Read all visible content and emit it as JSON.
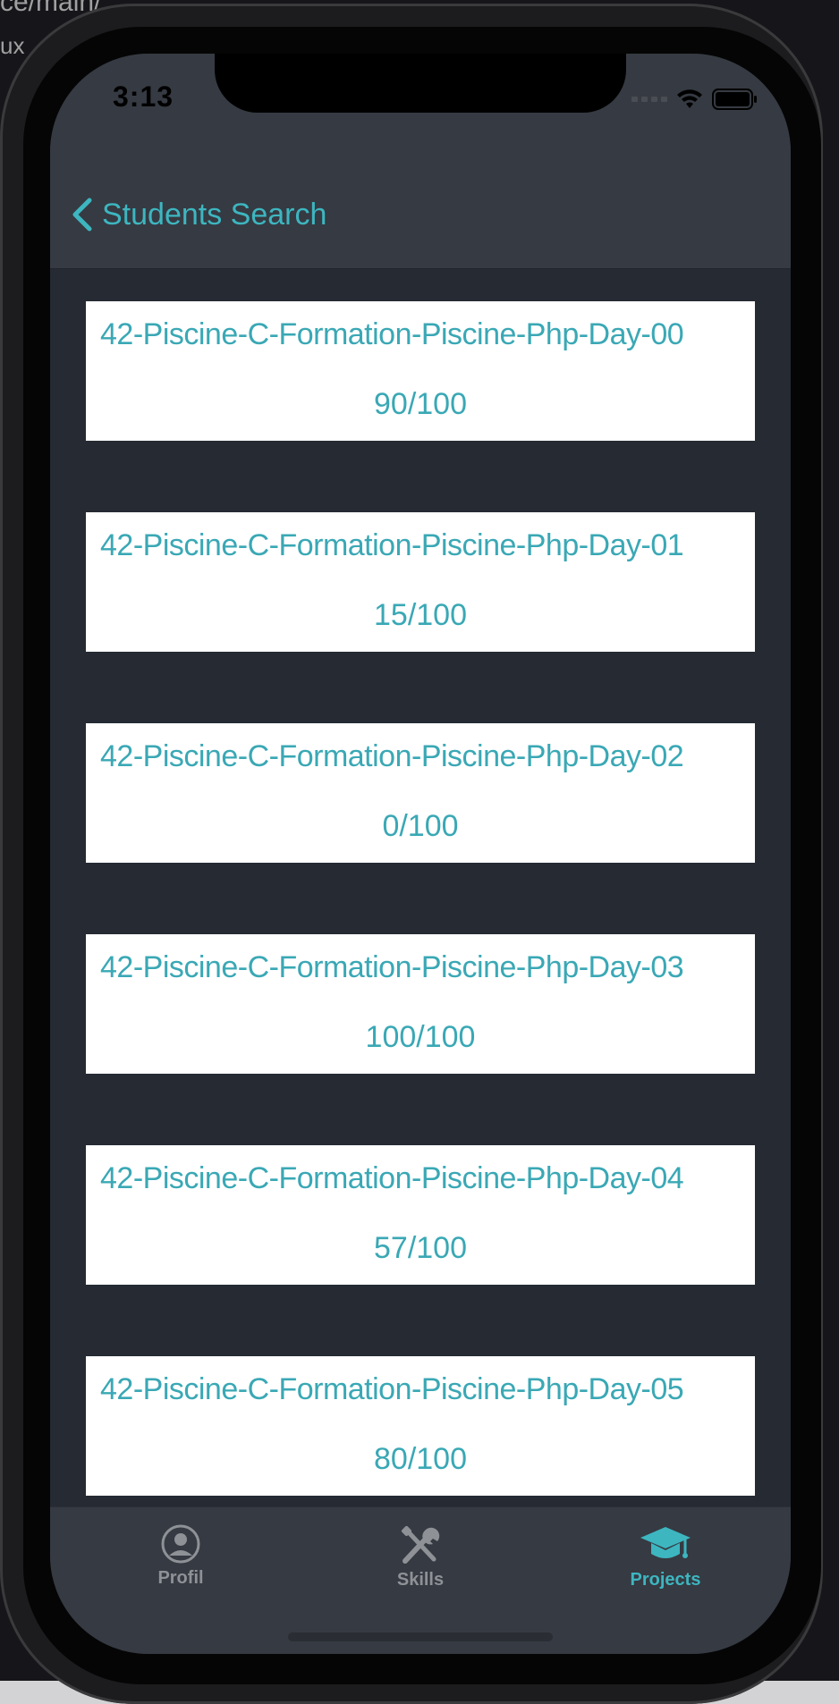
{
  "background_text": [
    "ce/main/",
    "ux"
  ],
  "status_bar": {
    "time": "3:13"
  },
  "nav": {
    "back_label": "Students Search"
  },
  "projects": [
    {
      "name": "42-Piscine-C-Formation-Piscine-Php-Day-00",
      "score": "90/100"
    },
    {
      "name": "42-Piscine-C-Formation-Piscine-Php-Day-01",
      "score": "15/100"
    },
    {
      "name": "42-Piscine-C-Formation-Piscine-Php-Day-02",
      "score": "0/100"
    },
    {
      "name": "42-Piscine-C-Formation-Piscine-Php-Day-03",
      "score": "100/100"
    },
    {
      "name": "42-Piscine-C-Formation-Piscine-Php-Day-04",
      "score": "57/100"
    },
    {
      "name": "42-Piscine-C-Formation-Piscine-Php-Day-05",
      "score": "80/100"
    }
  ],
  "tabs": [
    {
      "label": "Profil",
      "icon": "person-circle-icon",
      "active": false
    },
    {
      "label": "Skills",
      "icon": "tools-icon",
      "active": false
    },
    {
      "label": "Projects",
      "icon": "graduation-cap-icon",
      "active": true
    }
  ],
  "colors": {
    "accent": "#3db6c0",
    "screen_bg": "#252a33",
    "bar_bg": "#363a42",
    "card_bg": "#ffffff",
    "inactive_tab": "#8e9196"
  }
}
